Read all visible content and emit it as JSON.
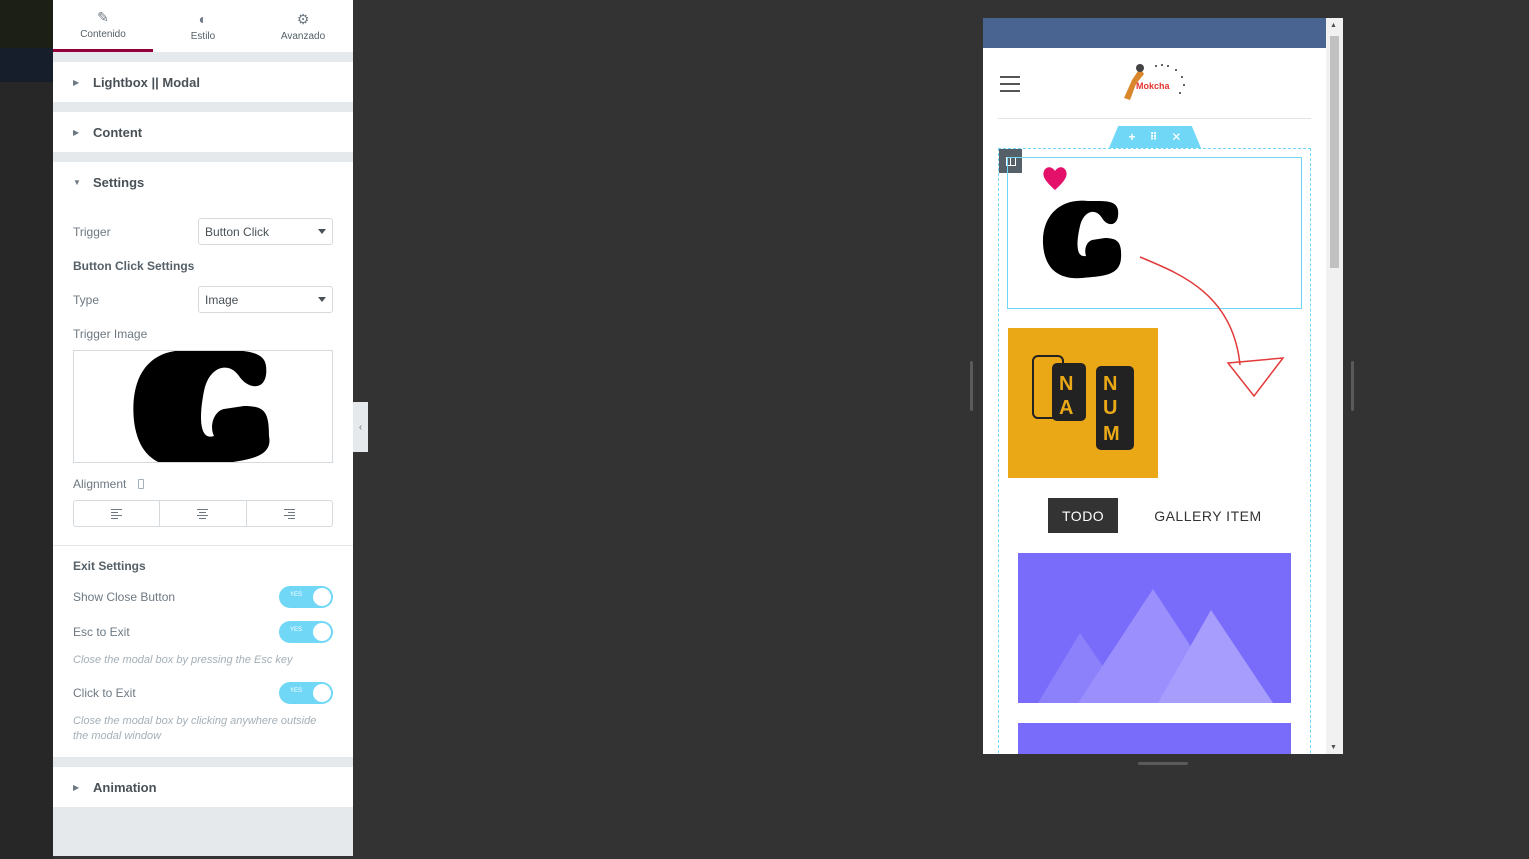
{
  "tabs": [
    {
      "label": "Contenido",
      "icon": "pencil-icon",
      "active": true
    },
    {
      "label": "Estilo",
      "icon": "contrast-icon",
      "active": false
    },
    {
      "label": "Avanzado",
      "icon": "gear-icon",
      "active": false
    }
  ],
  "sections": {
    "lightbox": "Lightbox || Modal",
    "content": "Content",
    "settings": "Settings",
    "animation": "Animation"
  },
  "settings": {
    "trigger_label": "Trigger",
    "trigger_value": "Button Click",
    "button_click_heading": "Button Click Settings",
    "type_label": "Type",
    "type_value": "Image",
    "trigger_image_label": "Trigger Image",
    "trigger_image_glyph": "G",
    "alignment_label": "Alignment",
    "exit_heading": "Exit Settings",
    "show_close_label": "Show Close Button",
    "esc_label": "Esc to Exit",
    "esc_note": "Close the modal box by pressing the Esc key",
    "click_label": "Click to Exit",
    "click_note": "Close the modal box by clicking anywhere outside the modal window",
    "toggle_yes": "YES"
  },
  "preview": {
    "logo_text": "Mokcha",
    "widget_glyph": "G",
    "sticker_text": "NA NUM",
    "filters": [
      "TODO",
      "GALLERY ITEM"
    ],
    "accent_color": "#71d7f7",
    "gallery_color": "#7a6cfa",
    "header_color": "#4a6491"
  }
}
